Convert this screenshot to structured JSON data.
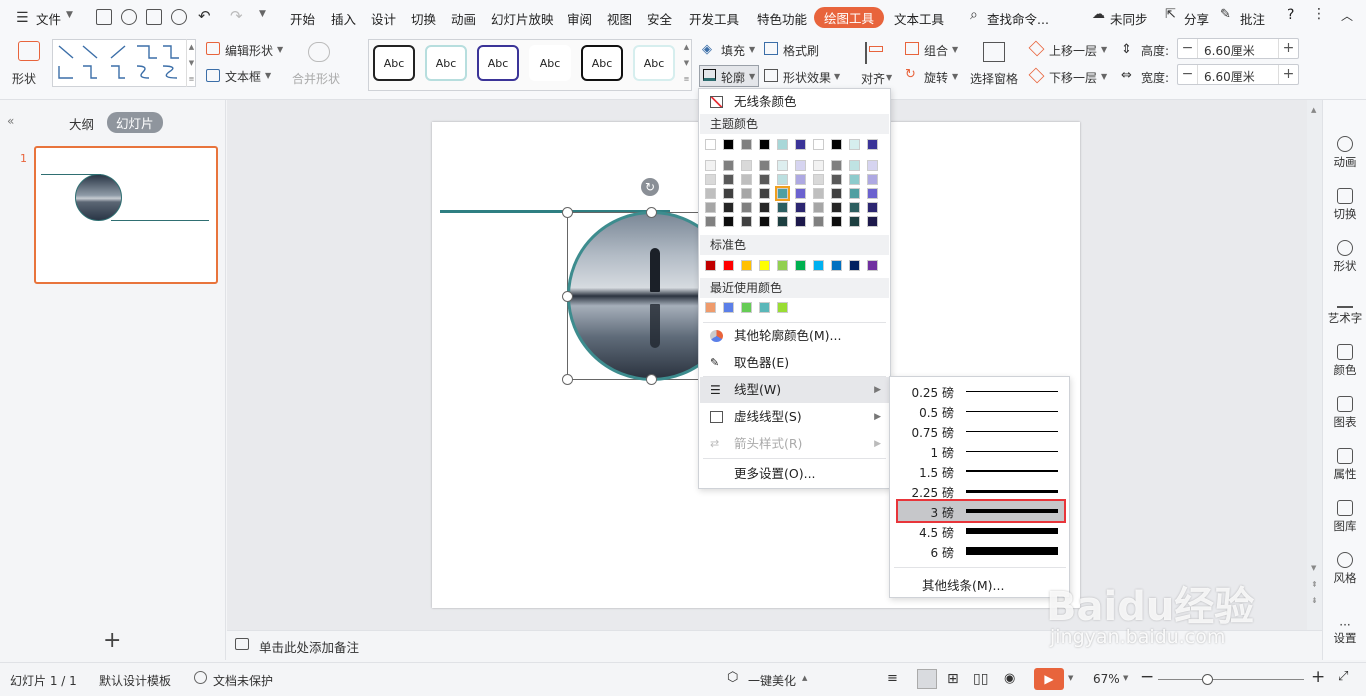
{
  "menubar": {
    "file": "文件",
    "tabs": [
      "开始",
      "插入",
      "设计",
      "切换",
      "动画",
      "幻灯片放映",
      "审阅",
      "视图",
      "安全",
      "开发工具",
      "特色功能",
      "绘图工具",
      "文本工具"
    ],
    "search": "查找命令...",
    "sync": "未同步",
    "share": "分享",
    "comment": "批注",
    "help": "?"
  },
  "ribbon": {
    "shape": "形状",
    "edit_shape": "编辑形状",
    "textbox": "文本框",
    "merge_shape": "合并形状",
    "style_labels": [
      "Abc",
      "Abc",
      "Abc",
      "Abc",
      "Abc",
      "Abc"
    ],
    "fill": "填充",
    "format_painter": "格式刷",
    "outline": "轮廓",
    "shape_effect": "形状效果",
    "align": "对齐",
    "group": "组合",
    "rotate": "旋转",
    "selection_pane": "选择窗格",
    "bring_forward": "上移一层",
    "send_backward": "下移一层",
    "height_label": "高度:",
    "height_value": "6.60厘米",
    "width_label": "宽度:",
    "width_value": "6.60厘米"
  },
  "leftpanel": {
    "outline_tab": "大纲",
    "slides_tab": "幻灯片",
    "slide_number": "1",
    "add": "+"
  },
  "rightbar": [
    "动画",
    "切换",
    "形状",
    "艺术字",
    "颜色",
    "图表",
    "属性",
    "图库",
    "风格",
    "设置"
  ],
  "notes": "单击此处添加备注",
  "statusbar": {
    "slide_info": "幻灯片 1 / 1",
    "template": "默认设计模板",
    "protection": "文档未保护",
    "beautify": "一键美化",
    "zoom": "67%"
  },
  "dropdown": {
    "no_line": "无线条颜色",
    "theme_colors": "主题颜色",
    "standard_colors": "标准色",
    "recent_colors": "最近使用颜色",
    "more_colors": "其他轮廓颜色(M)...",
    "eyedropper": "取色器(E)",
    "line_type": "线型(W)",
    "dash_type": "虚线线型(S)",
    "arrow_style": "箭头样式(R)",
    "more_settings": "更多设置(O)..."
  },
  "colors": {
    "theme_top": [
      "#ffffff",
      "#000000",
      "#7f7f7f",
      "#000000",
      "#a8d7d8",
      "#3b3498",
      "#ffffff",
      "#000000",
      "#d6eeee",
      "#3b3498"
    ],
    "standard": [
      "#c00000",
      "#ff0000",
      "#ffc000",
      "#ffff00",
      "#92d050",
      "#00b050",
      "#00b0f0",
      "#0070c0",
      "#002060",
      "#7030a0"
    ],
    "recent": [
      "#ef9b6c",
      "#5b7fe8",
      "#66cc55",
      "#5ab7b9",
      "#99dd33"
    ],
    "accent": "#e8643c"
  },
  "linewidths": {
    "items": [
      {
        "label": "0.25 磅",
        "pt": 0.25
      },
      {
        "label": "0.5 磅",
        "pt": 0.5
      },
      {
        "label": "0.75 磅",
        "pt": 0.75
      },
      {
        "label": "1 磅",
        "pt": 1
      },
      {
        "label": "1.5 磅",
        "pt": 1.5
      },
      {
        "label": "2.25 磅",
        "pt": 2.25
      },
      {
        "label": "3 磅",
        "pt": 3
      },
      {
        "label": "4.5 磅",
        "pt": 4.5
      },
      {
        "label": "6 磅",
        "pt": 6
      }
    ],
    "selected": "3 磅",
    "more": "其他线条(M)..."
  },
  "watermark": {
    "brand": "Baidu经验",
    "url": "jingyan.baidu.com"
  }
}
